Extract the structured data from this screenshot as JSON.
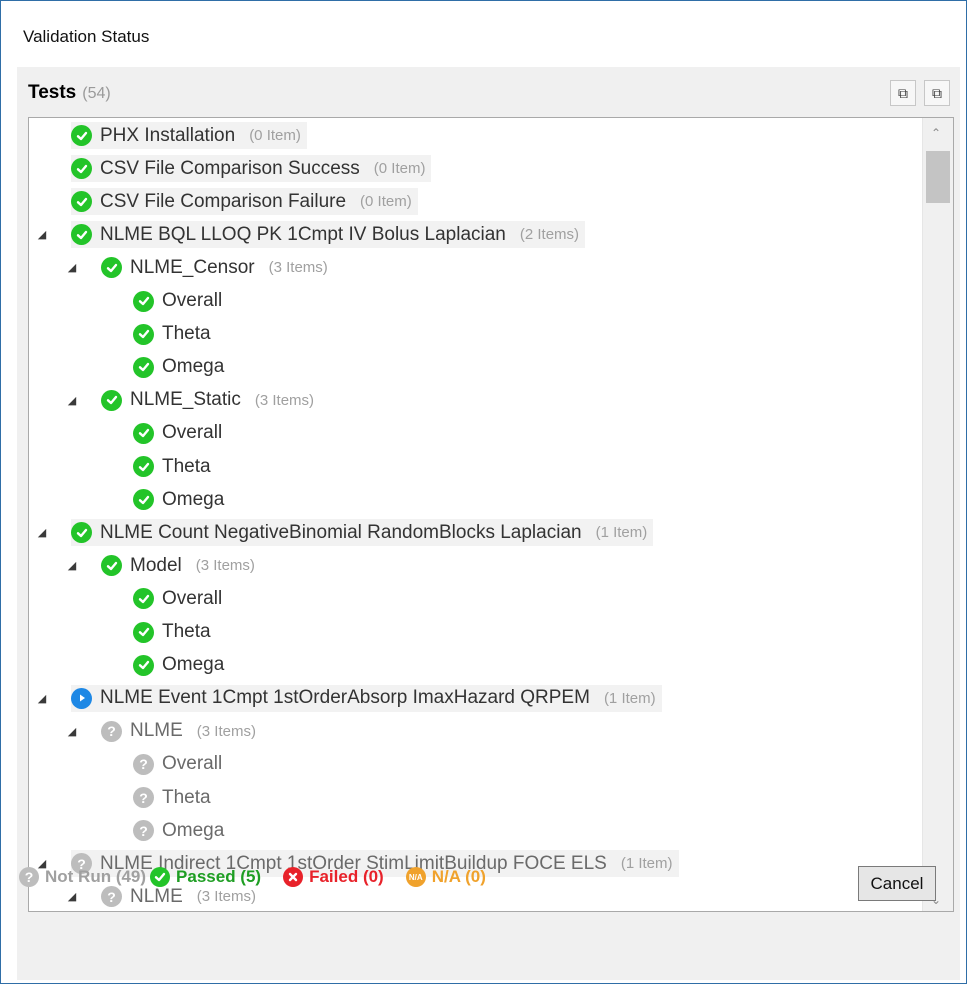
{
  "window": {
    "title": "Validation Status"
  },
  "tests": {
    "label": "Tests",
    "count": "(54)"
  },
  "toolbar": {
    "expand_icon": "expand-all-icon",
    "collapse_icon": "collapse-all-icon"
  },
  "tree": [
    {
      "label": "PHX Installation",
      "items": "(0 Item)",
      "status": "pass",
      "level": 0,
      "expander": false,
      "highlight": true
    },
    {
      "label": "CSV File Comparison Success",
      "items": "(0 Item)",
      "status": "pass",
      "level": 0,
      "expander": false,
      "highlight": true
    },
    {
      "label": "CSV File Comparison Failure",
      "items": "(0 Item)",
      "status": "pass",
      "level": 0,
      "expander": false,
      "highlight": true
    },
    {
      "label": "NLME BQL LLOQ PK 1Cmpt IV Bolus Laplacian",
      "items": "(2 Items)",
      "status": "pass",
      "level": 0,
      "expander": true,
      "highlight": true
    },
    {
      "label": "NLME_Censor",
      "items": "(3 Items)",
      "status": "pass",
      "level": 1,
      "expander": true,
      "highlight": false
    },
    {
      "label": "Overall",
      "items": "",
      "status": "pass",
      "level": 2,
      "expander": false,
      "highlight": false
    },
    {
      "label": "Theta",
      "items": "",
      "status": "pass",
      "level": 2,
      "expander": false,
      "highlight": false
    },
    {
      "label": "Omega",
      "items": "",
      "status": "pass",
      "level": 2,
      "expander": false,
      "highlight": false
    },
    {
      "label": "NLME_Static",
      "items": "(3 Items)",
      "status": "pass",
      "level": 1,
      "expander": true,
      "highlight": false
    },
    {
      "label": "Overall",
      "items": "",
      "status": "pass",
      "level": 2,
      "expander": false,
      "highlight": false
    },
    {
      "label": "Theta",
      "items": "",
      "status": "pass",
      "level": 2,
      "expander": false,
      "highlight": false
    },
    {
      "label": "Omega",
      "items": "",
      "status": "pass",
      "level": 2,
      "expander": false,
      "highlight": false
    },
    {
      "label": "NLME Count NegativeBinomial RandomBlocks Laplacian",
      "items": "(1 Item)",
      "status": "pass",
      "level": 0,
      "expander": true,
      "highlight": true
    },
    {
      "label": "Model",
      "items": "(3 Items)",
      "status": "pass",
      "level": 1,
      "expander": true,
      "highlight": false
    },
    {
      "label": "Overall",
      "items": "",
      "status": "pass",
      "level": 2,
      "expander": false,
      "highlight": false
    },
    {
      "label": "Theta",
      "items": "",
      "status": "pass",
      "level": 2,
      "expander": false,
      "highlight": false
    },
    {
      "label": "Omega",
      "items": "",
      "status": "pass",
      "level": 2,
      "expander": false,
      "highlight": false
    },
    {
      "label": "NLME Event 1Cmpt 1stOrderAbsorp ImaxHazard QRPEM",
      "items": "(1 Item)",
      "status": "running",
      "level": 0,
      "expander": true,
      "highlight": true
    },
    {
      "label": "NLME",
      "items": "(3 Items)",
      "status": "notrun",
      "level": 1,
      "expander": true,
      "highlight": false
    },
    {
      "label": "Overall",
      "items": "",
      "status": "notrun",
      "level": 2,
      "expander": false,
      "highlight": false
    },
    {
      "label": "Theta",
      "items": "",
      "status": "notrun",
      "level": 2,
      "expander": false,
      "highlight": false
    },
    {
      "label": "Omega",
      "items": "",
      "status": "notrun",
      "level": 2,
      "expander": false,
      "highlight": false
    },
    {
      "label": "NLME Indirect 1Cmpt 1stOrder StimLimitBuildup FOCE ELS",
      "items": "(1 Item)",
      "status": "notrun",
      "level": 0,
      "expander": true,
      "highlight": true
    },
    {
      "label": "NLME",
      "items": "(3 Items)",
      "status": "notrun",
      "level": 1,
      "expander": true,
      "highlight": false
    }
  ],
  "status_bar": {
    "not_run": "Not Run (49)",
    "passed": "Passed (5)",
    "failed": "Failed (0)",
    "na": "N/A (0)",
    "na_icon_text": "N/A",
    "colors": {
      "not_run": "#a0a0a0",
      "passed": "#1e9e23",
      "failed": "#e8222a",
      "na": "#f0a22c",
      "running": "#1e88e5"
    }
  },
  "buttons": {
    "cancel": "Cancel"
  }
}
